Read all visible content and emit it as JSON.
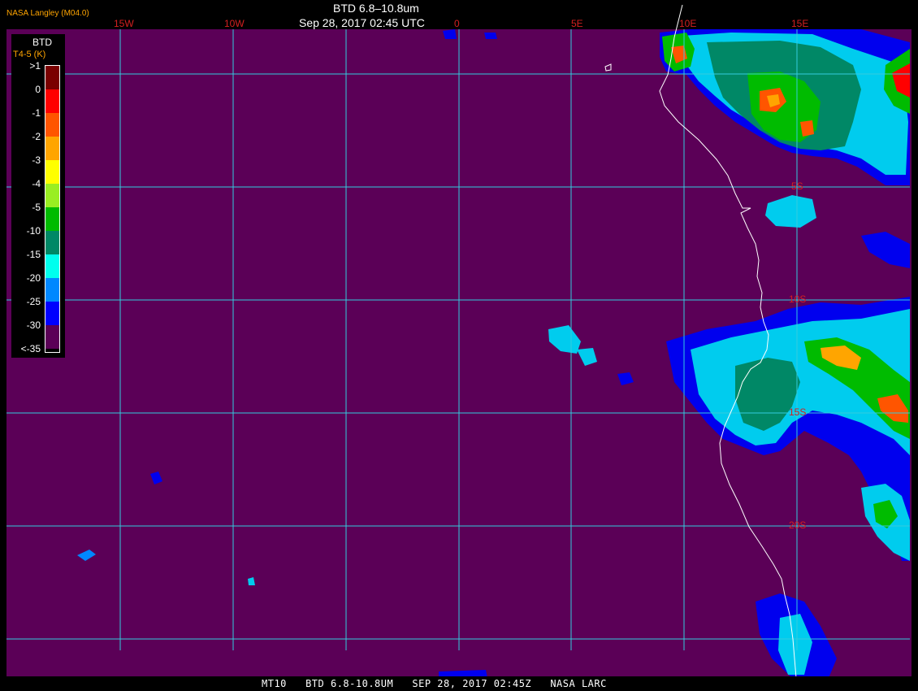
{
  "title": "BTD 6.8–10.8um",
  "timestamp": "Sep 28, 2017 02:45 UTC",
  "credit": "NASA Langley (M04.0)",
  "footer": "MT10   BTD 6.8-10.8UM   SEP 28, 2017 02:45Z   NASA LARC",
  "legend": {
    "title": "BTD",
    "subtitle": "T4-5 (K)",
    "entries": [
      {
        "label": ">1",
        "color": "#7a0000"
      },
      {
        "label": "0",
        "color": "#ff0000"
      },
      {
        "label": "-1",
        "color": "#ff5500"
      },
      {
        "label": "-2",
        "color": "#ffa500"
      },
      {
        "label": "-3",
        "color": "#ffff00"
      },
      {
        "label": "-4",
        "color": "#99ee22"
      },
      {
        "label": "-5",
        "color": "#00bb00"
      },
      {
        "label": "-10",
        "color": "#008866"
      },
      {
        "label": "-15",
        "color": "#00ffee"
      },
      {
        "label": "-20",
        "color": "#0088ff"
      },
      {
        "label": "-25",
        "color": "#0000ff"
      },
      {
        "label": "-30",
        "color": "#5b0057"
      },
      {
        "label": "<-35",
        "color": ""
      }
    ]
  },
  "grid": {
    "longitudes": [
      "15W",
      "10W",
      "",
      "0",
      "5E",
      "10E",
      "15E"
    ],
    "latitudes": [
      "5S",
      "10S",
      "15S",
      "20S"
    ]
  },
  "colors": {
    "background": "#5b0057",
    "gridline": "#33ccdd",
    "coastline": "#ffffff",
    "grid_label": "#d42020",
    "legend_subtitle": "#ffa500"
  },
  "icons": {
    "coastline": "coastline-line"
  }
}
